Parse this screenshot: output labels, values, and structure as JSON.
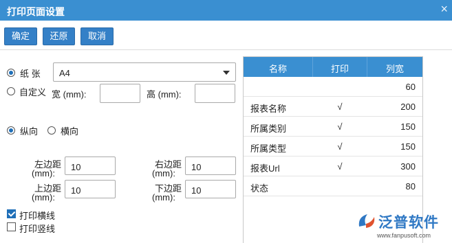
{
  "dialog": {
    "title": "打印页面设置",
    "close_icon": "×"
  },
  "toolbar": {
    "ok": "确定",
    "restore": "还原",
    "cancel": "取消"
  },
  "paper": {
    "paper_label": "纸 张",
    "paper_value": "A4",
    "custom_label": "自定义",
    "width_label": "宽 (mm):",
    "height_label": "高 (mm):",
    "width_value": "",
    "height_value": ""
  },
  "orientation": {
    "portrait": "纵向",
    "landscape": "横向",
    "selected": "portrait"
  },
  "margins": {
    "left_label_1": "左边距",
    "left_label_2": "(mm):",
    "left_value": "10",
    "right_label_1": "右边距",
    "right_label_2": "(mm):",
    "right_value": "10",
    "top_label_1": "上边距",
    "top_label_2": "(mm):",
    "top_value": "10",
    "bottom_label_1": "下边距",
    "bottom_label_2": "(mm):",
    "bottom_value": "10"
  },
  "options": {
    "hlines": "打印横线",
    "vlines": "打印竖线",
    "hlines_checked": true,
    "vlines_checked": false
  },
  "columns": {
    "headers": [
      "名称",
      "打印",
      "列宽"
    ],
    "rows": [
      {
        "name": "",
        "print": "",
        "width": "60"
      },
      {
        "name": "报表名称",
        "print": "√",
        "width": "200"
      },
      {
        "name": "所属类别",
        "print": "√",
        "width": "150"
      },
      {
        "name": "所属类型",
        "print": "√",
        "width": "150"
      },
      {
        "name": "报表Url",
        "print": "√",
        "width": "300"
      },
      {
        "name": "状态",
        "print": "",
        "width": "80"
      }
    ]
  },
  "watermark": {
    "brand": "泛普软件",
    "url": "www.fanpusoft.com"
  }
}
